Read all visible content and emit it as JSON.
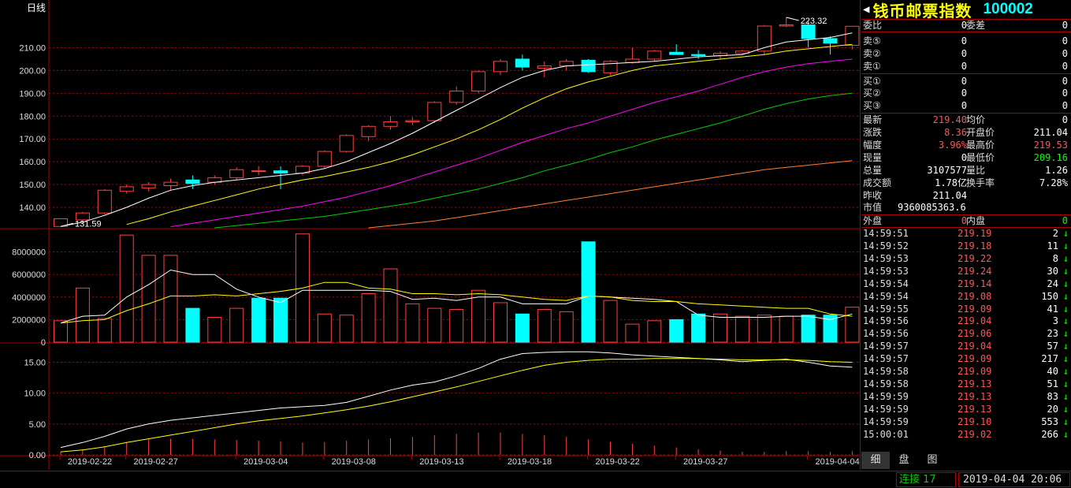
{
  "period_label": "日线",
  "title": {
    "name": "钱币邮票指数",
    "code": "100002",
    "arrow": "◀"
  },
  "ohl_marks": {
    "high": "223.32",
    "low": "131.59"
  },
  "colors": {
    "up": "#ff4040",
    "down": "#00ffff",
    "grid": "#aa0000",
    "ma5": "#ffffff",
    "ma10": "#ffff00",
    "ma20": "#ff00ff",
    "ma30": "#00cc00",
    "ma60": "#ff8030"
  },
  "order_book": {
    "ratio_label": "委比",
    "ratio_value": "0",
    "diff_label": "委差",
    "diff_value": "0",
    "asks": [
      {
        "label": "卖⑤",
        "price": "0",
        "vol": "0"
      },
      {
        "label": "卖②",
        "price": "0",
        "vol": "0"
      },
      {
        "label": "卖①",
        "price": "0",
        "vol": "0"
      }
    ],
    "bids": [
      {
        "label": "买①",
        "price": "0",
        "vol": "0"
      },
      {
        "label": "买②",
        "price": "0",
        "vol": "0"
      },
      {
        "label": "买③",
        "price": "0",
        "vol": "0"
      }
    ]
  },
  "quote": {
    "rows": [
      {
        "l1": "最新",
        "v1": "219.40",
        "v1c": "red",
        "l2": "均价",
        "v2": "0",
        "v2c": "white"
      },
      {
        "l1": "涨跌",
        "v1": "8.36",
        "v1c": "red",
        "l2": "开盘价",
        "v2": "211.04",
        "v2c": "white"
      },
      {
        "l1": "幅度",
        "v1": "3.96%",
        "v1c": "red",
        "l2": "最高价",
        "v2": "219.53",
        "v2c": "red"
      },
      {
        "l1": "现量",
        "v1": "0",
        "v1c": "white",
        "l2": "最低价",
        "v2": "209.16",
        "v2c": "green"
      },
      {
        "l1": "总量",
        "v1": "3107577",
        "v1c": "white",
        "l2": "量比",
        "v2": "1.26",
        "v2c": "white"
      },
      {
        "l1": "成交额",
        "v1": "1.78亿",
        "v1c": "white",
        "l2": "换手率",
        "v2": "7.28%",
        "v2c": "white"
      },
      {
        "l1": "昨收",
        "v1": "211.04",
        "v1c": "white",
        "l2": "",
        "v2": "",
        "v2c": "white"
      },
      {
        "l1": "市值",
        "v1": "9360085363.6",
        "v1c": "white",
        "l2": "",
        "v2": "",
        "v2c": "white"
      }
    ],
    "outer_label": "外盘",
    "outer_value": "0",
    "inner_label": "内盘",
    "inner_value": "0"
  },
  "ticks": [
    {
      "time": "14:59:51",
      "price": "219.19",
      "vol": "2",
      "dir": "↓"
    },
    {
      "time": "14:59:52",
      "price": "219.18",
      "vol": "11",
      "dir": "↓"
    },
    {
      "time": "14:59:53",
      "price": "219.22",
      "vol": "8",
      "dir": "↓"
    },
    {
      "time": "14:59:53",
      "price": "219.24",
      "vol": "30",
      "dir": "↓"
    },
    {
      "time": "14:59:54",
      "price": "219.14",
      "vol": "24",
      "dir": "↓"
    },
    {
      "time": "14:59:54",
      "price": "219.08",
      "vol": "150",
      "dir": "↓"
    },
    {
      "time": "14:59:55",
      "price": "219.09",
      "vol": "41",
      "dir": "↓"
    },
    {
      "time": "14:59:56",
      "price": "219.04",
      "vol": "3",
      "dir": "↓"
    },
    {
      "time": "14:59:56",
      "price": "219.06",
      "vol": "23",
      "dir": "↓"
    },
    {
      "time": "14:59:57",
      "price": "219.04",
      "vol": "57",
      "dir": "↓"
    },
    {
      "time": "14:59:57",
      "price": "219.09",
      "vol": "217",
      "dir": "↓"
    },
    {
      "time": "14:59:58",
      "price": "219.09",
      "vol": "40",
      "dir": "↓"
    },
    {
      "time": "14:59:58",
      "price": "219.13",
      "vol": "51",
      "dir": "↓"
    },
    {
      "time": "14:59:59",
      "price": "219.13",
      "vol": "83",
      "dir": "↓"
    },
    {
      "time": "14:59:59",
      "price": "219.13",
      "vol": "20",
      "dir": "↓"
    },
    {
      "time": "14:59:59",
      "price": "219.10",
      "vol": "553",
      "dir": "↓"
    },
    {
      "time": "15:00:01",
      "price": "219.02",
      "vol": "266",
      "dir": "↓"
    }
  ],
  "tabs": [
    "细",
    "盘",
    "图"
  ],
  "status": {
    "conn_label": "连接",
    "conn_count": "17",
    "datetime": "2019-04-04 20:06"
  },
  "chart_data": [
    {
      "type": "candlestick",
      "panel": "price",
      "y_ticks": [
        140,
        150,
        160,
        170,
        180,
        190,
        200,
        210
      ],
      "y_tick_labels": [
        "140.00",
        "150.00",
        "160.00",
        "170.00",
        "180.00",
        "190.00",
        "200.00",
        "210.00"
      ],
      "ylim": [
        131,
        224
      ],
      "x_dates": [
        "2019-02-22",
        "2019-02-27",
        "2019-03-04",
        "2019-03-08",
        "2019-03-13",
        "2019-03-18",
        "2019-03-22",
        "2019-03-27",
        "2019-04-04"
      ],
      "ohlc": [
        [
          131.6,
          135.2,
          131.59,
          135.0
        ],
        [
          134.5,
          138.0,
          134.0,
          137.5
        ],
        [
          137.5,
          148.0,
          137.0,
          147.5
        ],
        [
          147.0,
          150.0,
          146.0,
          149.0
        ],
        [
          148.5,
          151.0,
          147.0,
          150.0
        ],
        [
          149.5,
          152.5,
          147.5,
          151.0
        ],
        [
          152.0,
          154.0,
          148.0,
          150.5
        ],
        [
          151.0,
          154.0,
          150.0,
          153.0
        ],
        [
          153.0,
          157.5,
          152.0,
          156.5
        ],
        [
          156.0,
          158.0,
          154.0,
          156.0
        ],
        [
          156.0,
          158.0,
          148.0,
          155.0
        ],
        [
          155.0,
          158.5,
          154.0,
          158.0
        ],
        [
          158.0,
          165.0,
          157.0,
          164.5
        ],
        [
          164.5,
          172.0,
          164.0,
          171.5
        ],
        [
          171.0,
          176.0,
          169.0,
          175.5
        ],
        [
          175.5,
          180.0,
          174.0,
          177.5
        ],
        [
          177.5,
          179.5,
          176.0,
          178.0
        ],
        [
          178.0,
          186.5,
          177.0,
          186.0
        ],
        [
          186.0,
          193.0,
          185.0,
          191.0
        ],
        [
          191.0,
          200.0,
          190.0,
          199.5
        ],
        [
          199.5,
          205.0,
          198.0,
          204.0
        ],
        [
          205.0,
          207.0,
          200.0,
          201.5
        ],
        [
          201.0,
          204.0,
          197.0,
          202.0
        ],
        [
          202.0,
          205.0,
          200.0,
          204.0
        ],
        [
          204.5,
          205.0,
          199.0,
          199.5
        ],
        [
          199.0,
          204.5,
          198.0,
          204.0
        ],
        [
          203.5,
          210.0,
          203.0,
          205.0
        ],
        [
          205.0,
          209.0,
          204.0,
          208.5
        ],
        [
          208.0,
          211.5,
          207.0,
          207.0
        ],
        [
          207.0,
          209.0,
          205.0,
          206.5
        ],
        [
          206.5,
          208.5,
          205.0,
          207.5
        ],
        [
          207.5,
          209.0,
          207.0,
          208.5
        ],
        [
          208.5,
          220.0,
          207.0,
          219.5
        ],
        [
          219.5,
          223.32,
          219.0,
          220.0
        ],
        [
          220.0,
          222.0,
          210.0,
          214.0
        ],
        [
          214.0,
          215.0,
          207.0,
          212.0
        ],
        [
          211.04,
          219.53,
          209.16,
          219.4
        ]
      ],
      "series": [
        {
          "name": "MA5",
          "values": [
            131.6,
            133.5,
            136.5,
            140.0,
            144.0,
            147.5,
            149.5,
            151.0,
            152.0,
            153.0,
            154.0,
            155.0,
            157.0,
            160.0,
            164.0,
            168.0,
            172.5,
            177.5,
            182.5,
            187.5,
            192.5,
            197.0,
            200.0,
            202.0,
            202.5,
            203.0,
            203.5,
            204.0,
            205.0,
            206.0,
            206.5,
            207.0,
            210.0,
            212.5,
            213.5,
            214.5,
            216.5
          ]
        },
        {
          "name": "MA10",
          "values": [
            null,
            null,
            null,
            132.5,
            135.0,
            138.0,
            140.5,
            143.0,
            145.5,
            148.0,
            150.0,
            152.0,
            153.5,
            155.5,
            157.5,
            160.0,
            163.0,
            166.5,
            170.0,
            174.0,
            178.5,
            183.5,
            188.0,
            192.0,
            195.0,
            197.5,
            200.0,
            202.0,
            203.0,
            204.0,
            205.0,
            206.0,
            207.0,
            208.5,
            209.5,
            210.5,
            211.5
          ]
        },
        {
          "name": "MA20",
          "values": [
            null,
            null,
            null,
            null,
            null,
            131.5,
            133.0,
            134.5,
            136.0,
            137.5,
            139.0,
            140.5,
            142.5,
            144.5,
            147.0,
            149.5,
            152.5,
            155.5,
            158.5,
            161.5,
            165.0,
            168.5,
            171.5,
            174.5,
            177.0,
            180.0,
            183.0,
            186.0,
            188.5,
            191.0,
            194.0,
            197.0,
            199.5,
            201.5,
            203.0,
            204.0,
            205.0
          ]
        },
        {
          "name": "MA30",
          "values": [
            null,
            null,
            null,
            null,
            null,
            null,
            null,
            131.0,
            132.0,
            133.0,
            134.0,
            135.0,
            136.0,
            137.5,
            139.0,
            140.5,
            142.0,
            144.0,
            146.0,
            148.0,
            150.5,
            153.0,
            156.0,
            158.5,
            161.0,
            164.0,
            166.5,
            169.5,
            172.0,
            174.5,
            177.0,
            180.0,
            183.0,
            185.5,
            187.5,
            189.0,
            190.0
          ]
        },
        {
          "name": "MA60",
          "values": [
            null,
            null,
            null,
            null,
            null,
            null,
            null,
            null,
            null,
            null,
            null,
            null,
            null,
            null,
            131.0,
            132.0,
            133.0,
            134.0,
            135.5,
            137.0,
            138.5,
            140.0,
            141.5,
            143.0,
            144.5,
            146.0,
            147.5,
            149.0,
            150.5,
            152.0,
            153.5,
            155.0,
            156.5,
            157.5,
            158.5,
            159.5,
            160.5
          ]
        }
      ]
    },
    {
      "type": "bar",
      "panel": "volume",
      "y_ticks": [
        0,
        2000000,
        4000000,
        6000000,
        8000000
      ],
      "y_tick_labels": [
        "0",
        "2000000",
        "4000000",
        "6000000",
        "8000000"
      ],
      "ylim": [
        0,
        10000000
      ],
      "values": [
        1900000,
        4800000,
        2100000,
        9500000,
        7700000,
        7700000,
        3000000,
        2200000,
        3000000,
        3900000,
        3900000,
        9600000,
        2500000,
        2400000,
        4300000,
        6500000,
        3400000,
        3000000,
        2900000,
        4600000,
        3500000,
        2500000,
        2900000,
        2700000,
        8900000,
        3700000,
        1600000,
        1900000,
        2000000,
        2500000,
        2500000,
        2300000,
        2400000,
        2300000,
        2400000,
        2400000,
        3100000
      ],
      "up": [
        true,
        true,
        true,
        true,
        true,
        true,
        false,
        true,
        true,
        false,
        false,
        true,
        true,
        true,
        true,
        true,
        true,
        true,
        true,
        true,
        true,
        false,
        true,
        true,
        false,
        true,
        true,
        true,
        false,
        false,
        true,
        true,
        true,
        true,
        false,
        false,
        true
      ],
      "series": [
        {
          "name": "VMA5",
          "values": [
            1700000,
            2300000,
            2400000,
            4000000,
            5100000,
            6400000,
            6000000,
            6000000,
            4700000,
            4000000,
            3500000,
            4600000,
            4600000,
            4600000,
            4600000,
            4500000,
            3800000,
            3900000,
            3700000,
            4000000,
            4000000,
            3400000,
            3400000,
            3400000,
            4100000,
            4000000,
            3900000,
            3800000,
            3600000,
            2400000,
            2200000,
            2200000,
            2200000,
            2300000,
            2300000,
            2000000,
            2500000
          ]
        },
        {
          "name": "VMA10",
          "values": [
            1700000,
            1900000,
            2000000,
            2800000,
            3400000,
            4100000,
            4100000,
            4200000,
            4100000,
            4300000,
            4500000,
            4800000,
            5300000,
            5300000,
            4800000,
            4700000,
            4300000,
            4300000,
            4200000,
            4300000,
            4200000,
            4000000,
            3800000,
            3700000,
            4100000,
            4000000,
            3700000,
            3600000,
            3600000,
            3400000,
            3300000,
            3200000,
            3100000,
            3000000,
            3000000,
            2500000,
            2300000
          ]
        }
      ]
    },
    {
      "type": "line",
      "panel": "indicator",
      "y_ticks": [
        0,
        5,
        10,
        15
      ],
      "y_tick_labels": [
        "0.00",
        "5.00",
        "10.00",
        "15.00"
      ],
      "ylim": [
        0,
        18
      ],
      "series": [
        {
          "name": "L1",
          "values": [
            1.2,
            2.0,
            3.0,
            4.2,
            5.0,
            5.6,
            6.0,
            6.4,
            6.8,
            7.2,
            7.6,
            7.8,
            8.0,
            8.5,
            9.5,
            10.5,
            11.3,
            11.8,
            12.8,
            14.0,
            15.5,
            16.4,
            16.6,
            16.7,
            16.7,
            16.5,
            16.2,
            16.0,
            15.8,
            15.6,
            15.4,
            15.1,
            15.3,
            15.5,
            15.0,
            14.4,
            14.2
          ]
        },
        {
          "name": "L2",
          "values": [
            0.5,
            0.8,
            1.3,
            2.0,
            2.6,
            3.2,
            3.8,
            4.4,
            5.0,
            5.5,
            5.9,
            6.3,
            6.8,
            7.3,
            7.9,
            8.6,
            9.4,
            10.2,
            11.0,
            11.9,
            12.8,
            13.7,
            14.5,
            15.0,
            15.3,
            15.5,
            15.5,
            15.6,
            15.6,
            15.6,
            15.5,
            15.4,
            15.4,
            15.4,
            15.3,
            15.1,
            15.0
          ]
        }
      ],
      "bars": [
        0.5,
        0.9,
        1.4,
        2.1,
        2.5,
        2.6,
        2.6,
        2.5,
        2.4,
        2.3,
        2.2,
        2.0,
        2.1,
        2.3,
        2.5,
        2.7,
        2.9,
        3.2,
        3.4,
        3.6,
        3.6,
        3.4,
        3.2,
        2.9,
        2.5,
        2.1,
        1.8,
        1.5,
        1.2,
        0.9,
        0.7,
        0.5,
        0.5,
        0.6,
        0.6,
        0.5,
        0.6
      ]
    }
  ]
}
